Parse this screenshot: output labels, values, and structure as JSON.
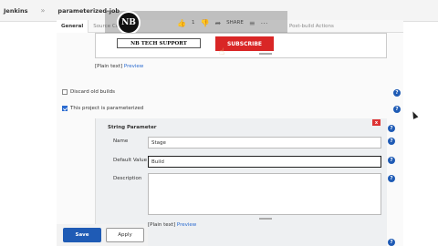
{
  "breadcrumb": {
    "root": "Jenkins",
    "separator": "»",
    "job": "parameterized-job"
  },
  "video_overlay": {
    "channel_logo": "NB",
    "like_count": "1",
    "share_label": "SHARE"
  },
  "tabs": [
    {
      "label": "General"
    },
    {
      "label": "Source Co"
    },
    {
      "label": "Post-build Actions"
    }
  ],
  "description": {
    "banner_text": "NB TECH SUPPORT",
    "subscribe_label": "SUBSCRIBE",
    "plain_text": "[Plain text]",
    "preview": "Preview"
  },
  "options": {
    "discard_old_builds": {
      "label": "Discard old builds",
      "checked": false
    },
    "parameterized": {
      "label": "This project is parameterized",
      "checked": true
    }
  },
  "string_parameter": {
    "title": "String Parameter",
    "delete_label": "x",
    "name_label": "Name",
    "name_value": "Stage",
    "default_label": "Default Value",
    "default_value": "Build",
    "description_label": "Description",
    "plain_text": "[Plain text]",
    "preview": "Preview"
  },
  "help_glyph": "?",
  "buttons": {
    "save": "Save",
    "apply": "Apply"
  },
  "colors": {
    "accent": "#1f5bb5",
    "subscribe": "#d92626"
  }
}
